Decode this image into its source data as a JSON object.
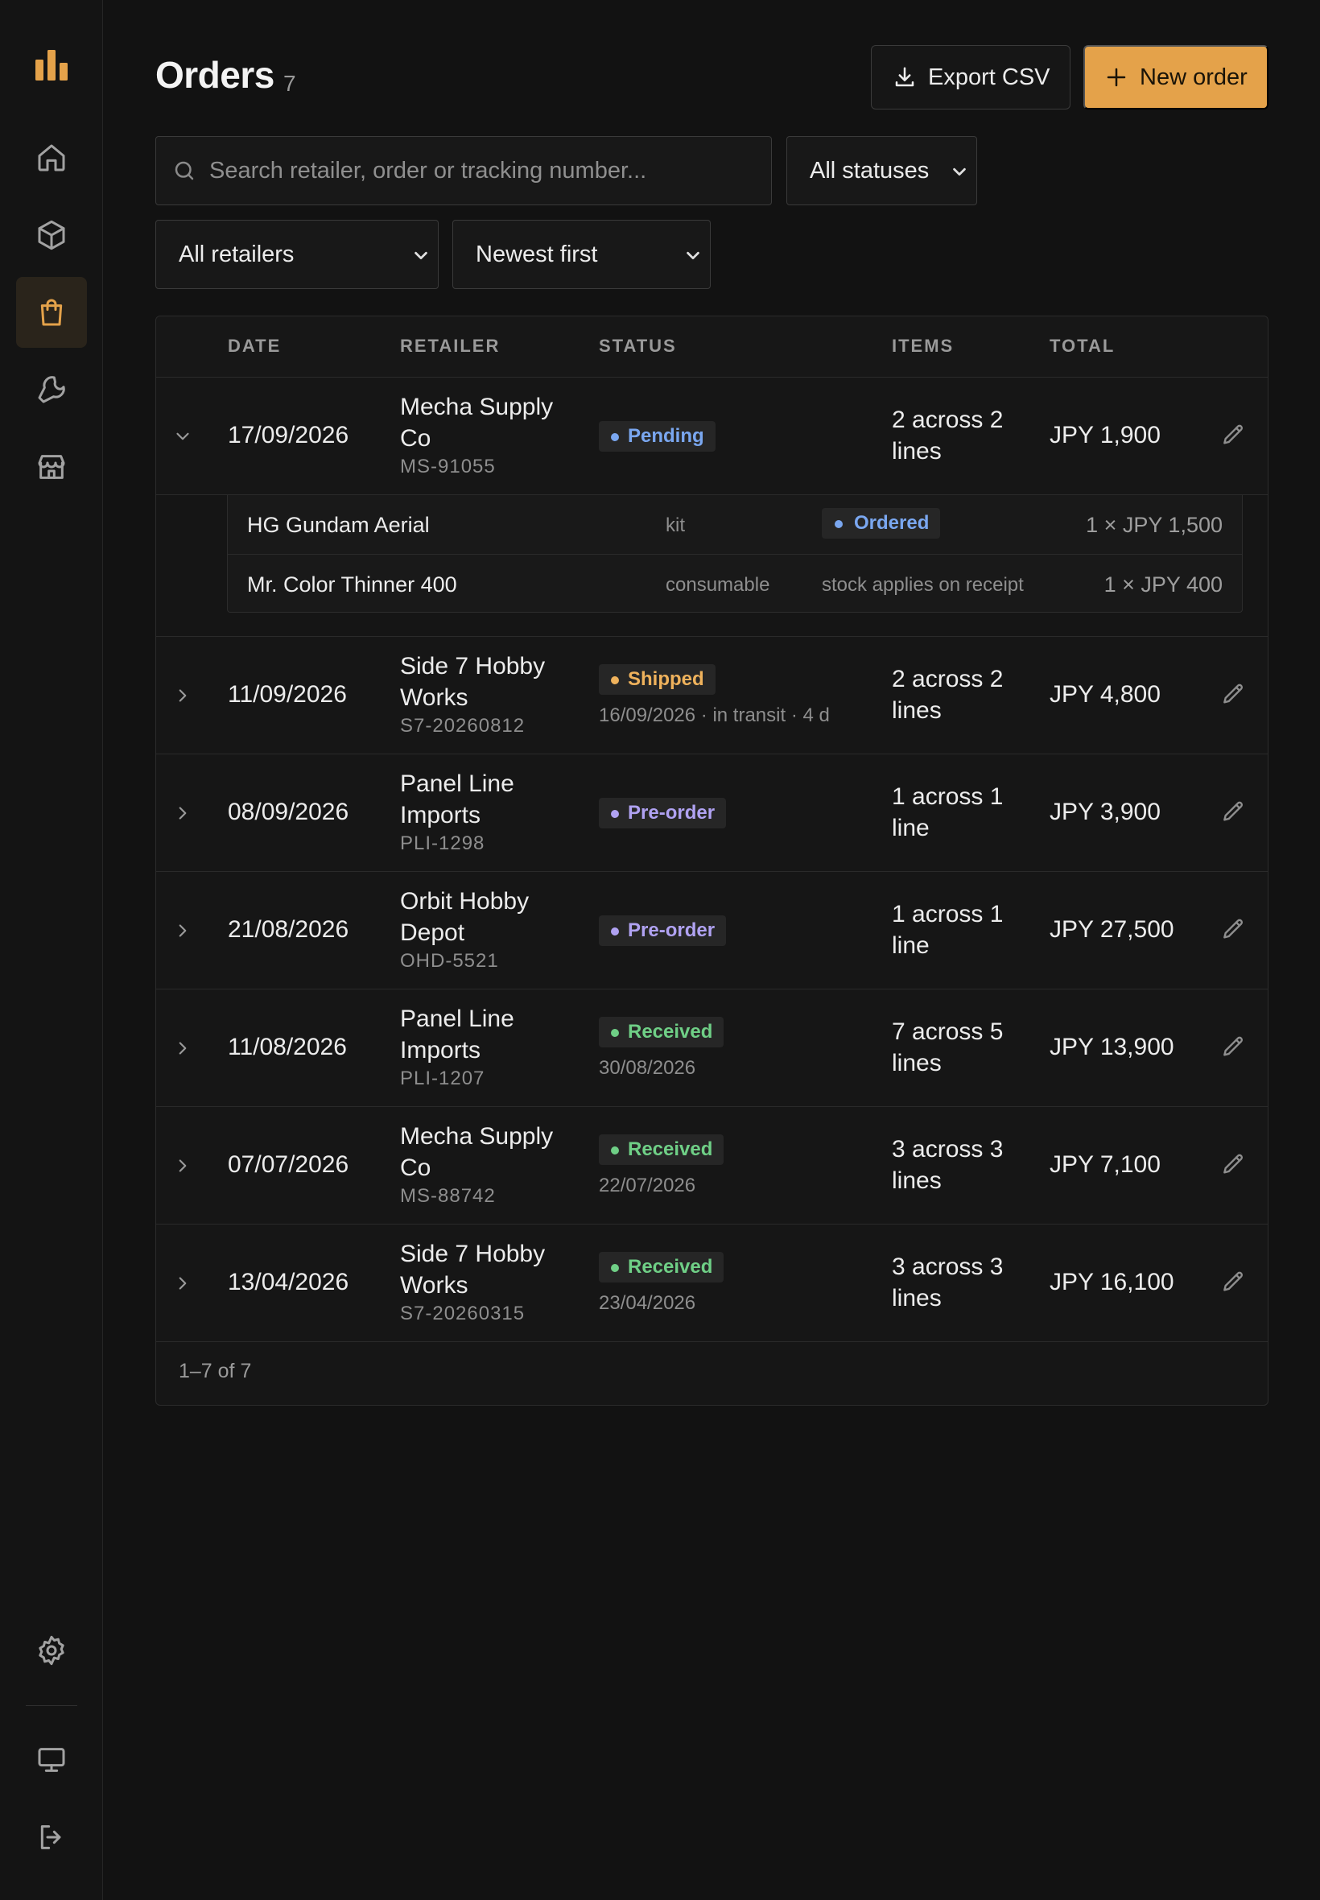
{
  "header": {
    "title": "Orders",
    "count": "7",
    "export_label": "Export CSV",
    "new_label": "New order"
  },
  "filters": {
    "search_placeholder": "Search retailer, order or tracking number...",
    "status_value": "All statuses",
    "retailer_value": "All retailers",
    "sort_value": "Newest first"
  },
  "sidebar": {
    "items": [
      "logo-icon",
      "home-icon",
      "box-icon",
      "shopping-bag-icon",
      "wrench-icon",
      "store-icon",
      "gear-icon",
      "monitor-icon",
      "logout-icon"
    ],
    "active": "shopping-bag-icon"
  },
  "colors": {
    "accent": "#e4a24a",
    "pending": "#7aa7f0",
    "shipped": "#efb25c",
    "preorder": "#b0a2f2",
    "received": "#6fcf86"
  },
  "table": {
    "columns": [
      "DATE",
      "RETAILER",
      "STATUS",
      "ITEMS",
      "TOTAL"
    ],
    "rows": [
      {
        "date": "17/09/2026",
        "retailer": "Mecha Supply Co",
        "ref": "MS-91055",
        "status": "Pending",
        "status_sub": "",
        "items": "2 across 2 lines",
        "total": "JPY 1,900"
      },
      {
        "date": "11/09/2026",
        "retailer": "Side 7 Hobby Works",
        "ref": "S7-20260812",
        "status": "Shipped",
        "status_sub": "16/09/2026 · in transit · 4 d",
        "items": "2 across 2 lines",
        "total": "JPY 4,800"
      },
      {
        "date": "08/09/2026",
        "retailer": "Panel Line Imports",
        "ref": "PLI-1298",
        "status": "Pre-order",
        "status_sub": "",
        "items": "1 across 1 line",
        "total": "JPY 3,900"
      },
      {
        "date": "21/08/2026",
        "retailer": "Orbit Hobby Depot",
        "ref": "OHD-5521",
        "status": "Pre-order",
        "status_sub": "",
        "items": "1 across 1 line",
        "total": "JPY 27,500"
      },
      {
        "date": "11/08/2026",
        "retailer": "Panel Line Imports",
        "ref": "PLI-1207",
        "status": "Received",
        "status_sub": "30/08/2026",
        "items": "7 across 5 lines",
        "total": "JPY 13,900"
      },
      {
        "date": "07/07/2026",
        "retailer": "Mecha Supply Co",
        "ref": "MS-88742",
        "status": "Received",
        "status_sub": "22/07/2026",
        "items": "3 across 3 lines",
        "total": "JPY 7,100"
      },
      {
        "date": "13/04/2026",
        "retailer": "Side 7 Hobby Works",
        "ref": "S7-20260315",
        "status": "Received",
        "status_sub": "23/04/2026",
        "items": "3 across 3 lines",
        "total": "JPY 16,100"
      }
    ],
    "expanded_lines": [
      {
        "name": "HG Gundam Aerial",
        "type": "kit",
        "status": "Ordered",
        "note": "",
        "qty": "1 × JPY 1,500"
      },
      {
        "name": "Mr. Color Thinner 400",
        "type": "consumable",
        "status": "",
        "note": "stock applies on receipt",
        "qty": "1 × JPY 400"
      }
    ],
    "footer": "1–7 of 7"
  }
}
